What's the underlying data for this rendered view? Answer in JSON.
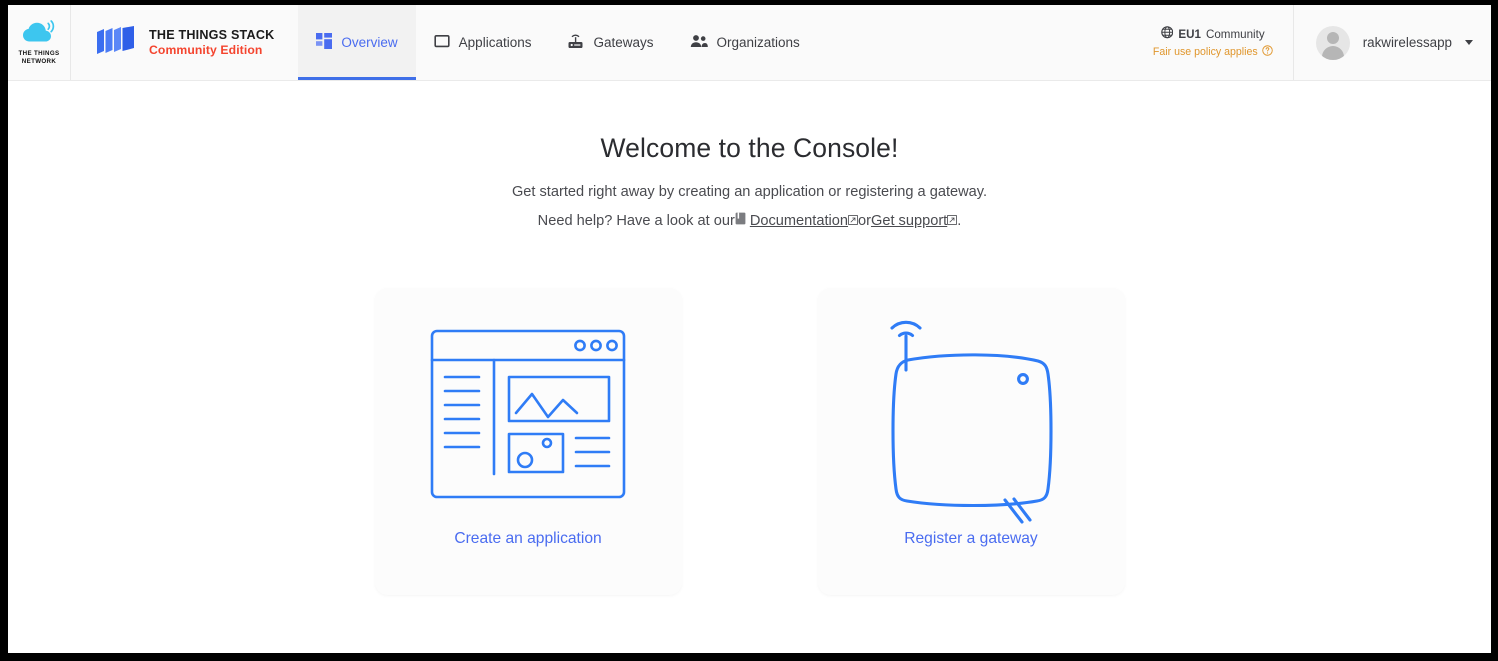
{
  "brand": {
    "ttn_logo_line1": "THE THINGS",
    "ttn_logo_line2": "NETWORK",
    "ttn_logo_icon": "cloud-signal-icon",
    "stack_title": "THE THINGS STACK",
    "stack_subtitle": "Community Edition",
    "stack_icon": "stacked-books-icon",
    "accent_blue": "#3f6fe8",
    "accent_red": "#f4442e",
    "cloud_blue": "#3dc6ef"
  },
  "nav": {
    "items": [
      {
        "label": "Overview",
        "icon": "grid-icon",
        "active": true
      },
      {
        "label": "Applications",
        "icon": "square-outline-icon",
        "active": false
      },
      {
        "label": "Gateways",
        "icon": "gateway-router-icon",
        "active": false
      },
      {
        "label": "Organizations",
        "icon": "people-icon",
        "active": false
      }
    ]
  },
  "cluster": {
    "globe_icon": "globe-icon",
    "region": "EU1",
    "region_suffix": "Community",
    "policy_text": "Fair use policy applies",
    "policy_icon": "question-circle-icon",
    "policy_color": "#e0962c"
  },
  "user": {
    "name": "rakwirelessapp",
    "avatar_icon": "user-avatar-icon",
    "caret_icon": "chevron-down-icon"
  },
  "main": {
    "title": "Welcome to the Console!",
    "subtitle": "Get started right away by creating an application or registering a gateway.",
    "help_prefix": "Need help? Have a look at our ",
    "documentation_label": "Documentation",
    "help_middle": " or ",
    "support_label": "Get support",
    "help_suffix": ".",
    "documentation_icon": "book-icon",
    "external_link_icon": "external-link-icon"
  },
  "cards": [
    {
      "label": "Create an application",
      "icon": "application-window-illustration"
    },
    {
      "label": "Register a gateway",
      "icon": "gateway-device-illustration"
    }
  ]
}
